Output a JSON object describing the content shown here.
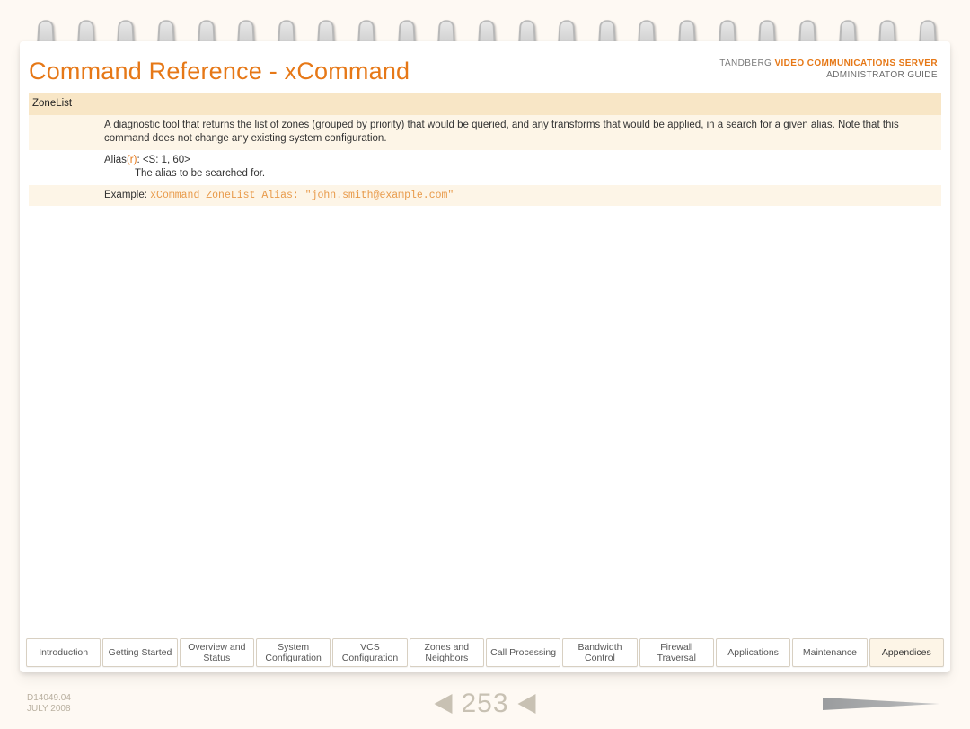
{
  "header": {
    "title": "Command Reference - xCommand",
    "brand": "TANDBERG",
    "product": "VIDEO COMMUNICATIONS SERVER",
    "subtitle": "ADMINISTRATOR GUIDE"
  },
  "command": {
    "name": "ZoneList",
    "description": "A diagnostic tool that returns the list of zones (grouped by priority) that would be queried, and any transforms that would be applied, in a search for a given alias. Note that this command does not change any existing system configuration.",
    "param_label": "Alias",
    "param_req_marker": "(r)",
    "param_signature": ": <S: 1, 60>",
    "param_desc": "The alias to be searched for.",
    "example_label": "Example:",
    "example_code": "xCommand ZoneList Alias: \"john.smith@example.com\""
  },
  "tabs": [
    "Introduction",
    "Getting Started",
    "Overview and Status",
    "System Configuration",
    "VCS Configuration",
    "Zones and Neighbors",
    "Call Processing",
    "Bandwidth Control",
    "Firewall Traversal",
    "Applications",
    "Maintenance",
    "Appendices"
  ],
  "active_tab_index": 11,
  "footer": {
    "doc_id": "D14049.04",
    "date": "JULY 2008",
    "page_number": "253"
  }
}
